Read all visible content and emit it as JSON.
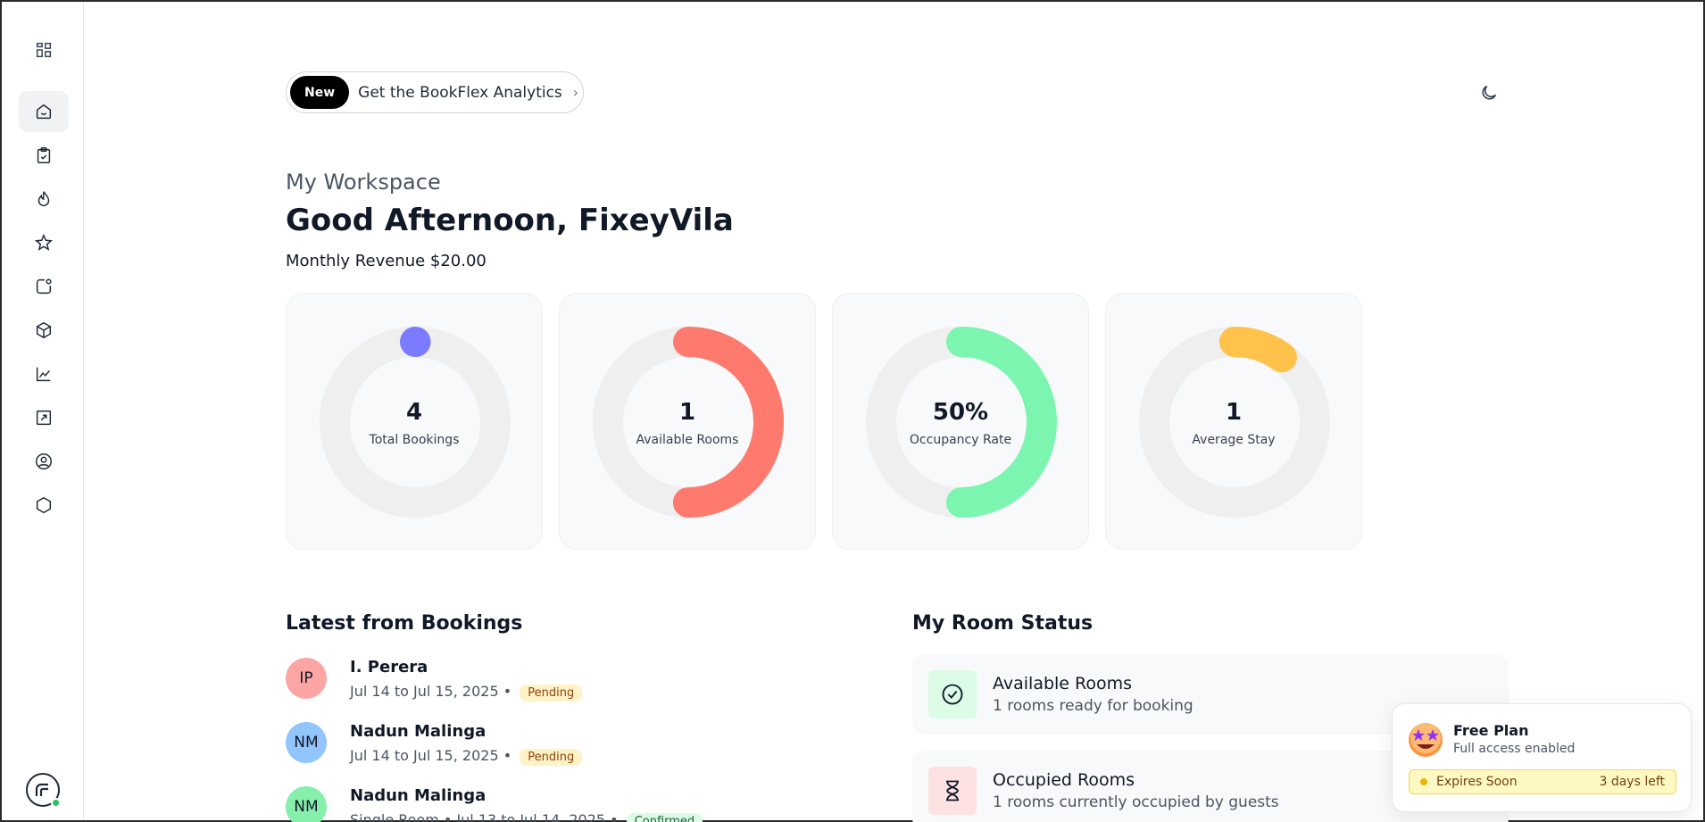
{
  "banner": {
    "badge": "New",
    "text": "Get the BookFlex Analytics",
    "chevron": "›"
  },
  "header": {
    "workspace_label": "My Workspace",
    "greeting": "Good Afternoon, FixeyVila",
    "revenue": "Monthly Revenue $20.00"
  },
  "sidebar": {
    "items": [
      {
        "icon": "layout-grid-icon"
      },
      {
        "icon": "home-face-icon",
        "active": true
      },
      {
        "icon": "clipboard-check-icon"
      },
      {
        "icon": "flame-icon"
      },
      {
        "icon": "star-icon"
      },
      {
        "icon": "notification-icon"
      },
      {
        "icon": "cube-icon"
      },
      {
        "icon": "line-chart-icon"
      },
      {
        "icon": "image-arrow-icon"
      },
      {
        "icon": "user-circle-icon"
      },
      {
        "icon": "hexagon-icon"
      }
    ],
    "logo": "brand-logo-icon"
  },
  "stats": [
    {
      "value": "4",
      "label": "Total Bookings",
      "color": "#7b7bff",
      "fraction": 0.0
    },
    {
      "value": "1",
      "label": "Available Rooms",
      "color": "#ff7a6e",
      "fraction": 0.5
    },
    {
      "value": "50%",
      "label": "Occupancy Rate",
      "color": "#7bf5b0",
      "fraction": 0.5
    },
    {
      "value": "1",
      "label": "Average Stay",
      "color": "#ffc24a",
      "fraction": 0.1
    }
  ],
  "bookings": {
    "title": "Latest from Bookings",
    "items": [
      {
        "initials": "IP",
        "name": "I. Perera",
        "meta": "Jul 14 to Jul 15, 2025 •",
        "status": "Pending",
        "avatar_color": "#fca5a5"
      },
      {
        "initials": "NM",
        "name": "Nadun Malinga",
        "meta": "Jul 14 to Jul 15, 2025 •",
        "status": "Pending",
        "avatar_color": "#93c5fd"
      },
      {
        "initials": "NM",
        "name": "Nadun Malinga",
        "meta": "Single Room • Jul 13 to Jul 14, 2025 •",
        "status": "Confirmed",
        "avatar_color": "#86efac"
      }
    ]
  },
  "rooms": {
    "title": "My Room Status",
    "items": [
      {
        "title": "Available Rooms",
        "subtitle": "1 rooms ready for booking",
        "icon": "check-circle-icon",
        "bg": "#dcfce7"
      },
      {
        "title": "Occupied Rooms",
        "subtitle": "1 rooms currently occupied by guests",
        "icon": "hourglass-icon",
        "bg": "#fee2e2"
      }
    ]
  },
  "plan": {
    "title": "Free Plan",
    "subtitle": "Full access enabled",
    "expire_label": "Expires Soon",
    "days_left": "3 days left"
  }
}
